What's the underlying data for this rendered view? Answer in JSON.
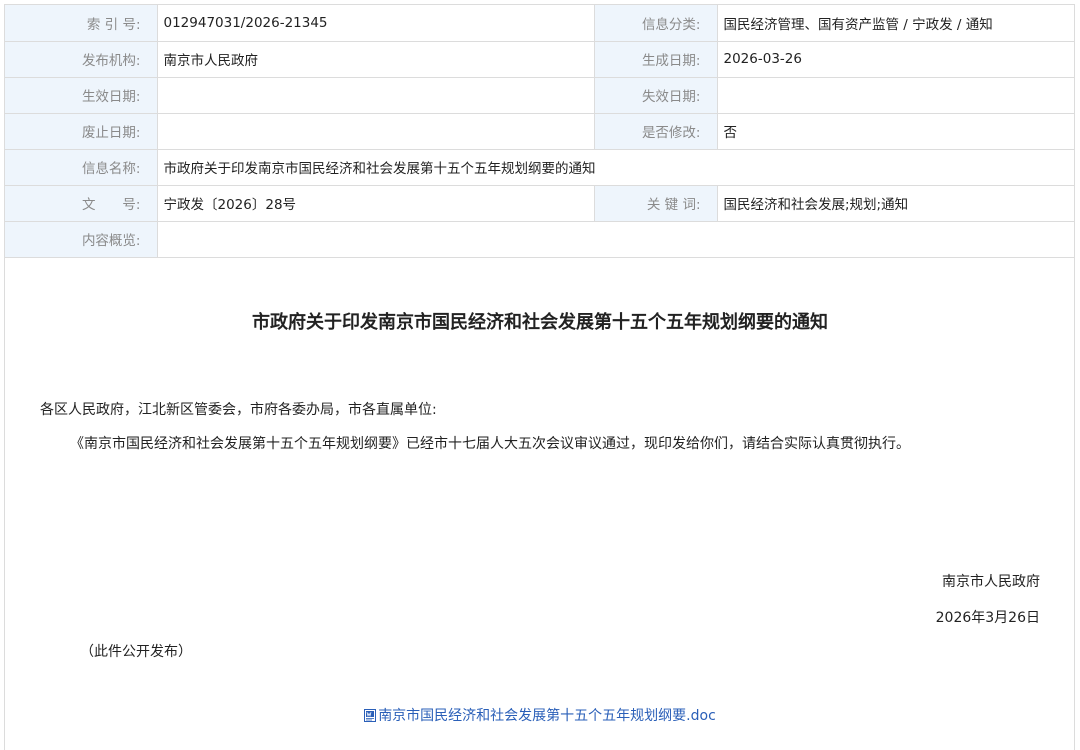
{
  "meta": {
    "index_label": "索 引 号:",
    "index_value": "012947031/2026-21345",
    "category_label": "信息分类:",
    "category_value": "国民经济管理、国有资产监管 / 宁政发 / 通知",
    "publisher_label": "发布机构:",
    "publisher_value": "南京市人民政府",
    "generated_label": "生成日期:",
    "generated_value": "2026-03-26",
    "effective_label": "生效日期:",
    "effective_value": "",
    "expire_label": "失效日期:",
    "expire_value": "",
    "abolish_label": "废止日期:",
    "abolish_value": "",
    "modified_label": "是否修改:",
    "modified_value": "否",
    "name_label": "信息名称:",
    "name_value": "市政府关于印发南京市国民经济和社会发展第十五个五年规划纲要的通知",
    "docno_label": "文　　号:",
    "docno_value": "宁政发〔2026〕28号",
    "keywords_label": "关 键 词:",
    "keywords_value": "国民经济和社会发展;规划;通知",
    "summary_label": "内容概览:",
    "summary_value": ""
  },
  "document": {
    "title": "市政府关于印发南京市国民经济和社会发展第十五个五年规划纲要的通知",
    "salutation": "各区人民政府，江北新区管委会，市府各委办局，市各直属单位:",
    "paragraph": "《南京市国民经济和社会发展第十五个五年规划纲要》已经市十七届人大五次会议审议通过，现印发给你们，请结合实际认真贯彻执行。",
    "signature": "南京市人民政府",
    "date": "2026年3月26日",
    "publish_note": "（此件公开发布）",
    "attachment": "南京市国民经济和社会发展第十五个五年规划纲要.doc"
  },
  "colors": {
    "label_bg": "#eef5fc",
    "border": "#dcdcdc",
    "link": "#2a5fb8"
  }
}
